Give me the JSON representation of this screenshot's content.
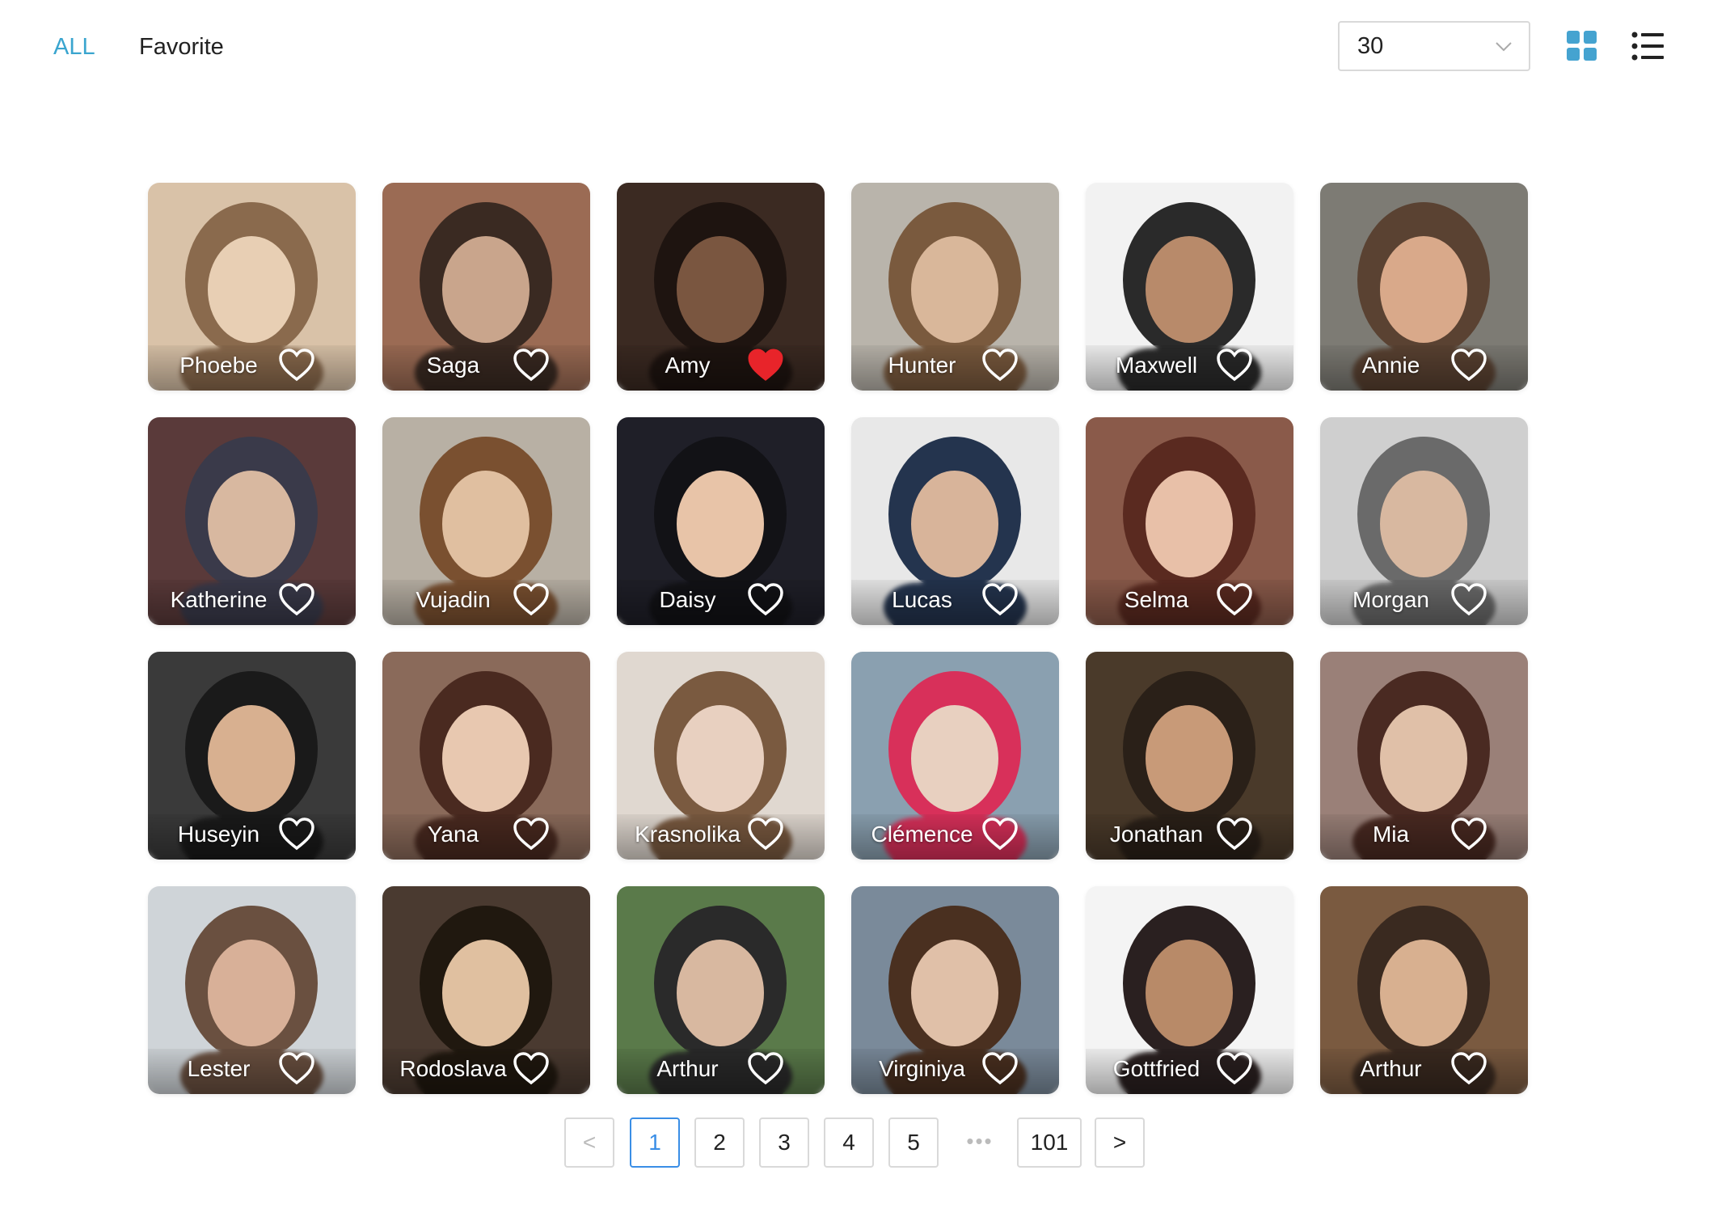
{
  "tabs": {
    "all": "ALL",
    "favorite": "Favorite"
  },
  "page_size": {
    "value": "30"
  },
  "colors": {
    "accent": "#3aa5cf",
    "favorite_heart": "#e8242a",
    "grid_icon": "#45a3d0"
  },
  "icons": {
    "grid_view": "grid-view-icon",
    "list_view": "list-view-icon",
    "favorite": "heart-icon",
    "dropdown": "chevron-down-icon"
  },
  "cards": [
    {
      "name": "Phoebe",
      "favorite": false
    },
    {
      "name": "Saga",
      "favorite": false
    },
    {
      "name": "Amy",
      "favorite": true
    },
    {
      "name": "Hunter",
      "favorite": false
    },
    {
      "name": "Maxwell",
      "favorite": false
    },
    {
      "name": "Annie",
      "favorite": false
    },
    {
      "name": "Katherine",
      "favorite": false
    },
    {
      "name": "Vujadin",
      "favorite": false
    },
    {
      "name": "Daisy",
      "favorite": false
    },
    {
      "name": "Lucas",
      "favorite": false
    },
    {
      "name": "Selma",
      "favorite": false
    },
    {
      "name": "Morgan",
      "favorite": false
    },
    {
      "name": "Huseyin",
      "favorite": false
    },
    {
      "name": "Yana",
      "favorite": false
    },
    {
      "name": "Krasnolika",
      "favorite": false
    },
    {
      "name": "Clémence",
      "favorite": false
    },
    {
      "name": "Jonathan",
      "favorite": false
    },
    {
      "name": "Mia",
      "favorite": false
    },
    {
      "name": "Lester",
      "favorite": false
    },
    {
      "name": "Rodoslava",
      "favorite": false
    },
    {
      "name": "Arthur",
      "favorite": false
    },
    {
      "name": "Virginiya",
      "favorite": false
    },
    {
      "name": "Gottfried",
      "favorite": false
    },
    {
      "name": "Arthur",
      "favorite": false
    }
  ],
  "pagination": {
    "prev": "<",
    "next": ">",
    "current": "1",
    "pages": [
      "1",
      "2",
      "3",
      "4",
      "5"
    ],
    "ellipsis": "•••",
    "last": "101"
  }
}
